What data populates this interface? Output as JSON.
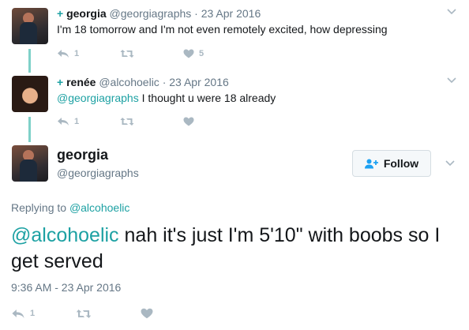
{
  "tweets": [
    {
      "prefix": "+",
      "name": "georgia",
      "handle": "@georgiagraphs",
      "date": "· 23 Apr 2016",
      "text": "I'm 18 tomorrow and I'm not even remotely excited, how depressing",
      "reply_count": "1",
      "retweet_count": "",
      "like_count": "5"
    },
    {
      "prefix": "+",
      "name": "renée",
      "handle": "@alcohoelic",
      "date": "· 23 Apr 2016",
      "mention": "@georgiagraphs",
      "text": " I thought u were 18 already",
      "reply_count": "1",
      "retweet_count": "",
      "like_count": ""
    }
  ],
  "main_tweet": {
    "name": "georgia",
    "handle": "@georgiagraphs",
    "follow_label": "Follow",
    "replying_prefix": "Replying to ",
    "replying_handle": "@alcohoelic",
    "mention": "@alcohoelic",
    "text": " nah it's just I'm 5'10\" with boobs so I get served",
    "timestamp": "9:36 AM - 23 Apr 2016",
    "reply_count": "1"
  },
  "icons": [
    "reply-icon",
    "retweet-icon",
    "like-icon",
    "chevron-down-icon",
    "follow-user-icon"
  ],
  "colors": {
    "accent": "#1da1a3",
    "muted": "#657786",
    "icon": "#aab8c2",
    "thread": "#7fd1c8"
  }
}
